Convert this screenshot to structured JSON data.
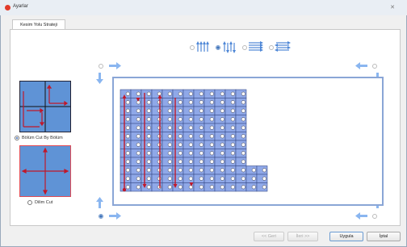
{
  "window": {
    "title": "Ayarlar",
    "close": "✕"
  },
  "tabs": [
    {
      "label": "Kesim Yolu Stratejisi",
      "label_visible": "Kesim Yolu  Strateji"
    }
  ],
  "options": {
    "bolum": {
      "label": "Bölüm Cut By Bölüm",
      "checked": true
    },
    "dilim": {
      "label": "Dilim Cut",
      "checked": false
    }
  },
  "path_icons": [
    "vertical-zigzag-icon",
    "vertical-snake-icon",
    "horizontal-zigzag-icon",
    "horizontal-snake-icon"
  ],
  "grid": {
    "columns": 12,
    "rows": 12,
    "short_columns": 2,
    "short_rows": 3
  },
  "buttons": {
    "back": "<< Geri",
    "next": "İleri >>",
    "apply": "Uygula",
    "cancel": "İptal"
  },
  "colors": {
    "accent": "#5f93d6",
    "path": "#c0182a",
    "cell": "#8fa8e8",
    "arrow": "#8ab6f0"
  }
}
